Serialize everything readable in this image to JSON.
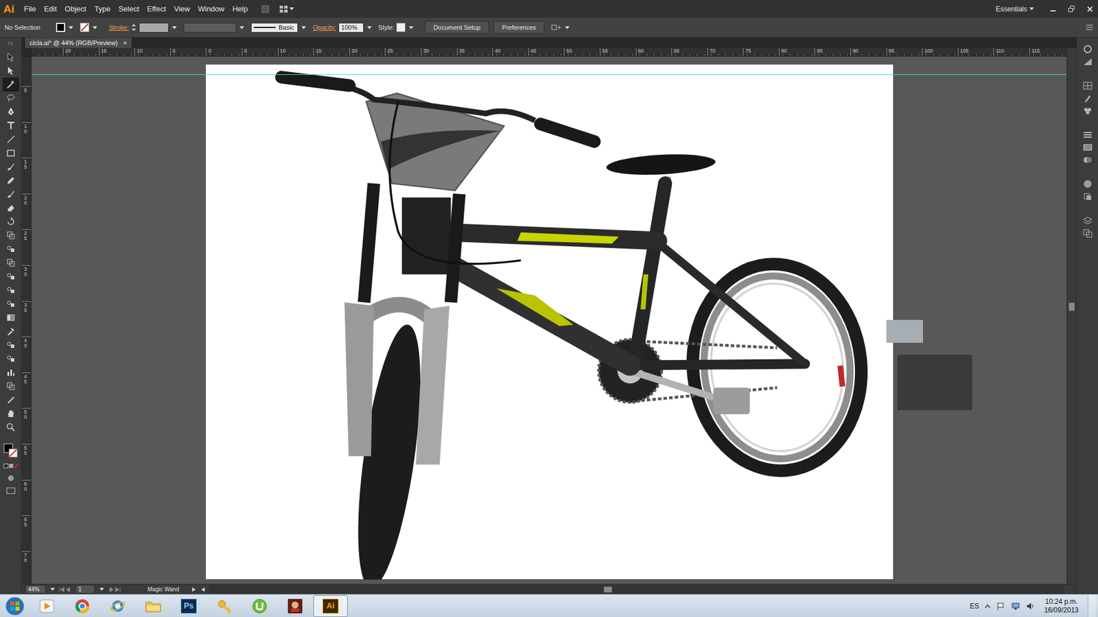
{
  "app": {
    "logo": "Ai",
    "menu": [
      "File",
      "Edit",
      "Object",
      "Type",
      "Select",
      "Effect",
      "View",
      "Window",
      "Help"
    ],
    "workspace": "Essentials"
  },
  "control_bar": {
    "selection": "No Selection",
    "stroke_label": "Stroke:",
    "brush": "Basic",
    "opacity_label": "Opacity:",
    "opacity": "100%",
    "style_label": "Style:",
    "buttons": [
      "Document Setup",
      "Preferences"
    ]
  },
  "document_tab": {
    "label": "cicla.ai* @ 44% (RGB/Preview)",
    "close": "×"
  },
  "rulers": {
    "top": [
      "20",
      "15",
      "10",
      "5",
      "0",
      "5",
      "10",
      "15",
      "20",
      "25",
      "30",
      "35",
      "40",
      "45",
      "50",
      "55",
      "60",
      "65",
      "70",
      "75",
      "80",
      "85",
      "90",
      "95",
      "100",
      "105",
      "110",
      "115"
    ],
    "left": [
      "5",
      "10",
      "15",
      "20",
      "25",
      "30",
      "35",
      "40",
      "45",
      "50",
      "55",
      "60",
      "65",
      "70"
    ]
  },
  "tools": [
    {
      "selected": false
    },
    {
      "selected": false
    },
    {
      "selected": true
    },
    {
      "selected": false
    },
    {
      "selected": false
    },
    {
      "selected": false
    },
    {
      "selected": false
    },
    {
      "selected": false
    },
    {
      "selected": false
    },
    {
      "selected": false
    },
    {
      "selected": false
    },
    {
      "selected": false
    },
    {
      "selected": false
    },
    {
      "selected": false
    },
    {
      "selected": false
    },
    {
      "selected": false
    },
    {
      "selected": false
    },
    {
      "selected": false
    },
    {
      "selected": false
    },
    {
      "selected": false
    },
    {
      "selected": false
    },
    {
      "selected": false
    },
    {
      "selected": false
    },
    {
      "selected": false
    },
    {
      "selected": false
    },
    {
      "selected": false
    },
    {
      "selected": false
    },
    {
      "selected": false
    }
  ],
  "status_bar": {
    "zoom": "44%",
    "page": "1",
    "tool": "Magic Wand"
  },
  "taskbar": {
    "apps": [
      {
        "kind": "media",
        "selected": false
      },
      {
        "kind": "chrome",
        "selected": false
      },
      {
        "kind": "ie",
        "selected": false
      },
      {
        "kind": "folder",
        "selected": false
      },
      {
        "kind": "ps",
        "label": "Ps",
        "selected": false
      },
      {
        "kind": "tool",
        "selected": false
      },
      {
        "kind": "torrent",
        "selected": false
      },
      {
        "kind": "game",
        "selected": false
      },
      {
        "kind": "ai",
        "label": "Ai",
        "selected": true
      }
    ],
    "language": "ES",
    "time": "10:24 p.m.",
    "date": "16/09/2013"
  }
}
